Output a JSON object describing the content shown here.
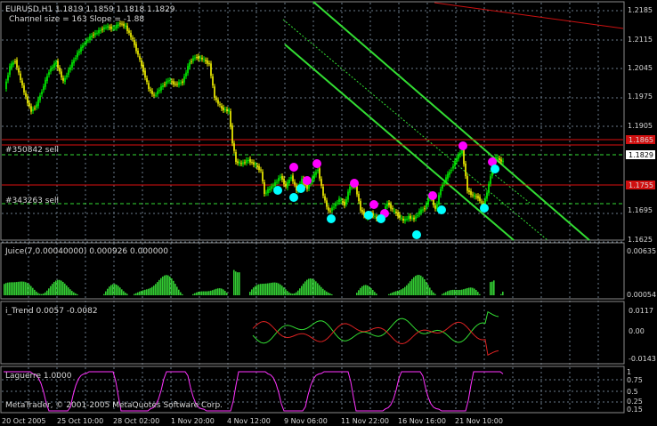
{
  "main": {
    "symbol_header": "EURUSD,H1  1.1819 1.1859 1.1818 1.1829",
    "channel_info": "Channel size = 163 Slope = -1.88",
    "order_labels": [
      "#350842 sell",
      "#343263 sell"
    ],
    "price_ticks": [
      "1.2185",
      "1.2115",
      "1.2045",
      "1.1975",
      "1.1905",
      "1.1829",
      "1.1695",
      "1.1625"
    ],
    "price_tags": [
      {
        "text": "1.1865",
        "bg": "#d01010"
      },
      {
        "text": "1.1829",
        "bg": "#ffffff"
      },
      {
        "text": "1.1755",
        "bg": "#d01010"
      }
    ]
  },
  "panels": {
    "juice": {
      "title": "Juice(7,0.00040000) 0.000926 0.000000",
      "ticks": [
        "0.00635",
        "0.00054"
      ]
    },
    "itrend": {
      "title": "i_Trend 0.0057 -0.0082",
      "ticks": [
        "0.0117",
        "0.00",
        "-0.0143"
      ]
    },
    "laguerre": {
      "title": "Laguerre 1.0000",
      "ticks": [
        "1",
        "0.75",
        "0.5",
        "0.25",
        "0.15"
      ],
      "copyright": "MetaTrader, © 2001-2005 MetaQuotes Software Corp."
    }
  },
  "time_axis": [
    "20 Oct 2005",
    "25 Oct 10:00",
    "28 Oct 02:00",
    "1 Nov 20:00",
    "4 Nov 12:00",
    "9 Nov 06:00",
    "11 Nov 22:00",
    "16 Nov 16:00",
    "21 Nov 10:00"
  ],
  "colors": {
    "background": "#000000",
    "bull_candle": "#00ff00",
    "bear_candle": "#ffff00",
    "channel": "#33dd33",
    "order_level": "#dd1111",
    "histogram": "#33cc33",
    "laguerre": "#ff33ff",
    "buy_marker": "#00ffff",
    "sell_marker": "#ff00ff"
  }
}
